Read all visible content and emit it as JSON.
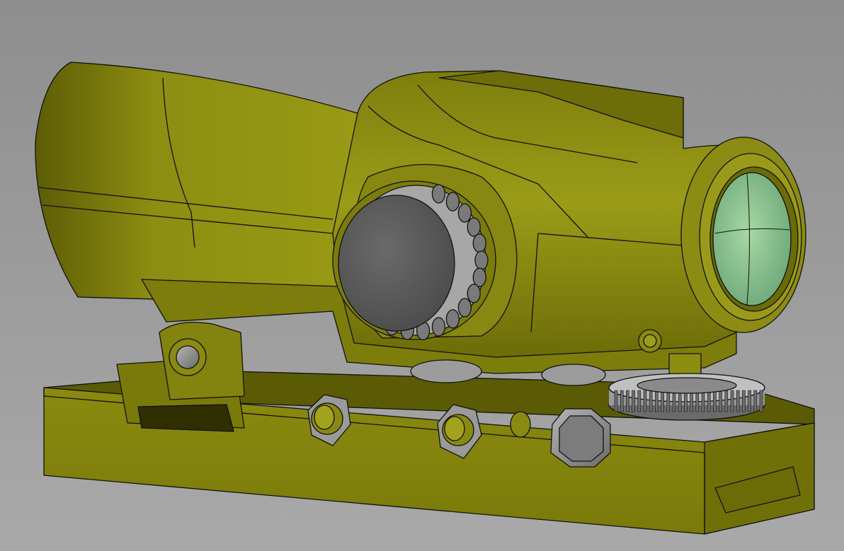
{
  "scene": {
    "subject": "cad-model-rifle-scope",
    "colors": {
      "body_olive": "#8f8f12",
      "body_highlight": "#a3a31c",
      "body_shadow": "#4f4f05",
      "hardware_gray": "#5a5a5a",
      "hardware_light": "#9a9a9a",
      "lens_green": "#8cc493",
      "edge_line": "#111111",
      "background_top": "#8e8e8e",
      "background_bottom": "#a9a9a9"
    },
    "icons": {
      "turret": "knob-icon",
      "lens": "lens-icon",
      "nut": "hex-nut-icon"
    }
  }
}
